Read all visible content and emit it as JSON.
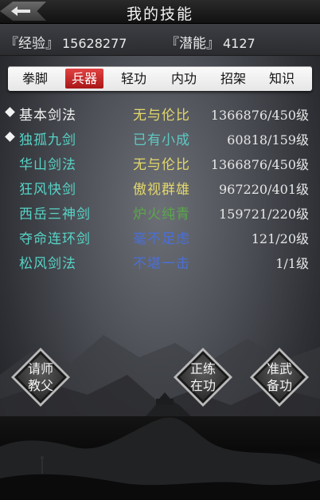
{
  "title": "我的技能",
  "stats": {
    "exp_label": "『经验』",
    "exp_value": "15628277",
    "potential_label": "『潜能』",
    "potential_value": "4127"
  },
  "tabs": [
    {
      "label": "拳脚",
      "active": false
    },
    {
      "label": "兵器",
      "active": true
    },
    {
      "label": "轻功",
      "active": false
    },
    {
      "label": "内功",
      "active": false
    },
    {
      "label": "招架",
      "active": false
    },
    {
      "label": "知识",
      "active": false
    }
  ],
  "skills": [
    {
      "name": "基本剑法",
      "rank": "无与伦比",
      "level": "1366876/450级",
      "marked": true,
      "name_color": "#f2f2f2",
      "rank_color": "#e3d76b"
    },
    {
      "name": "独孤九剑",
      "rank": "已有小成",
      "level": "60818/159级",
      "marked": true,
      "name_color": "#57d3c6",
      "rank_color": "#5ec9c3"
    },
    {
      "name": "华山剑法",
      "rank": "无与伦比",
      "level": "1366876/450级",
      "marked": false,
      "name_color": "#57d3c6",
      "rank_color": "#e3d76b"
    },
    {
      "name": "狂风快剑",
      "rank": "傲视群雄",
      "level": "967220/401级",
      "marked": false,
      "name_color": "#57d3c6",
      "rank_color": "#e3d76b"
    },
    {
      "name": "西岳三神剑",
      "rank": "炉火纯青",
      "level": "159721/220级",
      "marked": false,
      "name_color": "#57d3c6",
      "rank_color": "#5aa84a"
    },
    {
      "name": "夺命连环剑",
      "rank": "毫不足虑",
      "level": "121/20级",
      "marked": false,
      "name_color": "#57d3c6",
      "rank_color": "#4a6fd6"
    },
    {
      "name": "松风剑法",
      "rank": "不堪一击",
      "level": "1/1级",
      "marked": false,
      "name_color": "#57d3c6",
      "rank_color": "#4a6fd6"
    }
  ],
  "actions": {
    "ask_teacher": [
      "请师",
      "教父"
    ],
    "practicing": [
      "正练",
      "在功"
    ],
    "prepare": [
      "准武",
      "备功"
    ]
  }
}
